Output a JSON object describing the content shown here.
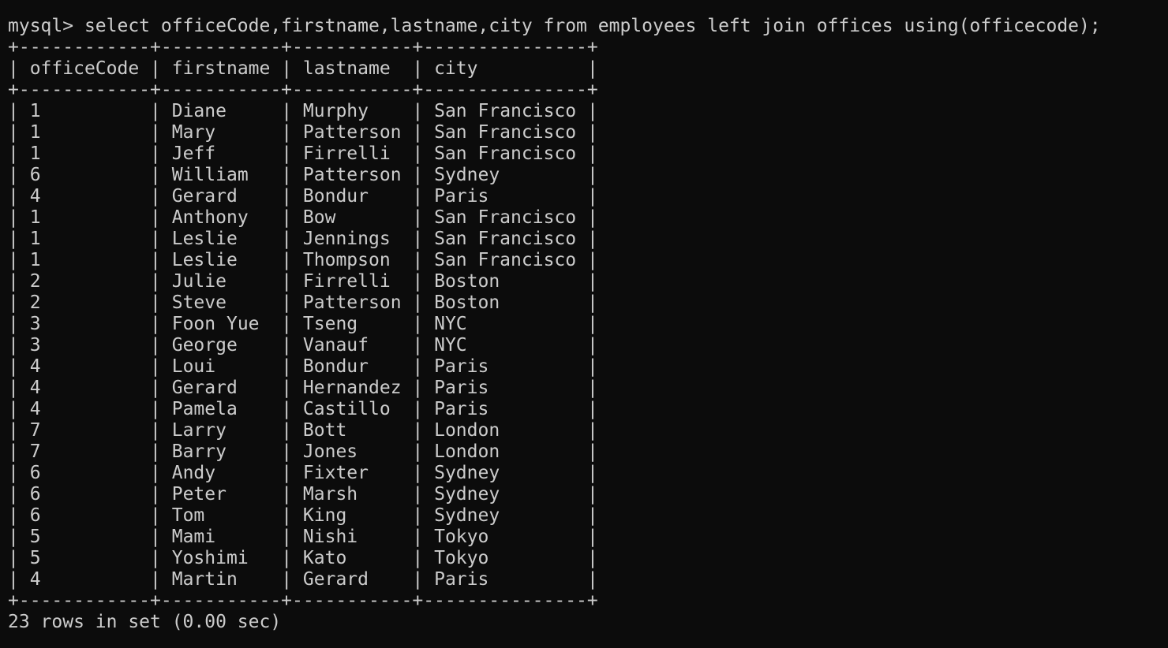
{
  "terminal": {
    "prompt": "mysql> ",
    "command": "select officeCode,firstname,lastname,city from employees left join offices using(officecode);",
    "footer": "23 rows in set (0.00 sec)"
  },
  "table": {
    "columns": [
      "officeCode",
      "firstname",
      "lastname",
      "city"
    ],
    "rows": [
      [
        "1",
        "Diane",
        "Murphy",
        "San Francisco"
      ],
      [
        "1",
        "Mary",
        "Patterson",
        "San Francisco"
      ],
      [
        "1",
        "Jeff",
        "Firrelli",
        "San Francisco"
      ],
      [
        "6",
        "William",
        "Patterson",
        "Sydney"
      ],
      [
        "4",
        "Gerard",
        "Bondur",
        "Paris"
      ],
      [
        "1",
        "Anthony",
        "Bow",
        "San Francisco"
      ],
      [
        "1",
        "Leslie",
        "Jennings",
        "San Francisco"
      ],
      [
        "1",
        "Leslie",
        "Thompson",
        "San Francisco"
      ],
      [
        "2",
        "Julie",
        "Firrelli",
        "Boston"
      ],
      [
        "2",
        "Steve",
        "Patterson",
        "Boston"
      ],
      [
        "3",
        "Foon Yue",
        "Tseng",
        "NYC"
      ],
      [
        "3",
        "George",
        "Vanauf",
        "NYC"
      ],
      [
        "4",
        "Loui",
        "Bondur",
        "Paris"
      ],
      [
        "4",
        "Gerard",
        "Hernandez",
        "Paris"
      ],
      [
        "4",
        "Pamela",
        "Castillo",
        "Paris"
      ],
      [
        "7",
        "Larry",
        "Bott",
        "London"
      ],
      [
        "7",
        "Barry",
        "Jones",
        "London"
      ],
      [
        "6",
        "Andy",
        "Fixter",
        "Sydney"
      ],
      [
        "6",
        "Peter",
        "Marsh",
        "Sydney"
      ],
      [
        "6",
        "Tom",
        "King",
        "Sydney"
      ],
      [
        "5",
        "Mami",
        "Nishi",
        "Tokyo"
      ],
      [
        "5",
        "Yoshimi",
        "Kato",
        "Tokyo"
      ],
      [
        "4",
        "Martin",
        "Gerard",
        "Paris"
      ]
    ]
  }
}
